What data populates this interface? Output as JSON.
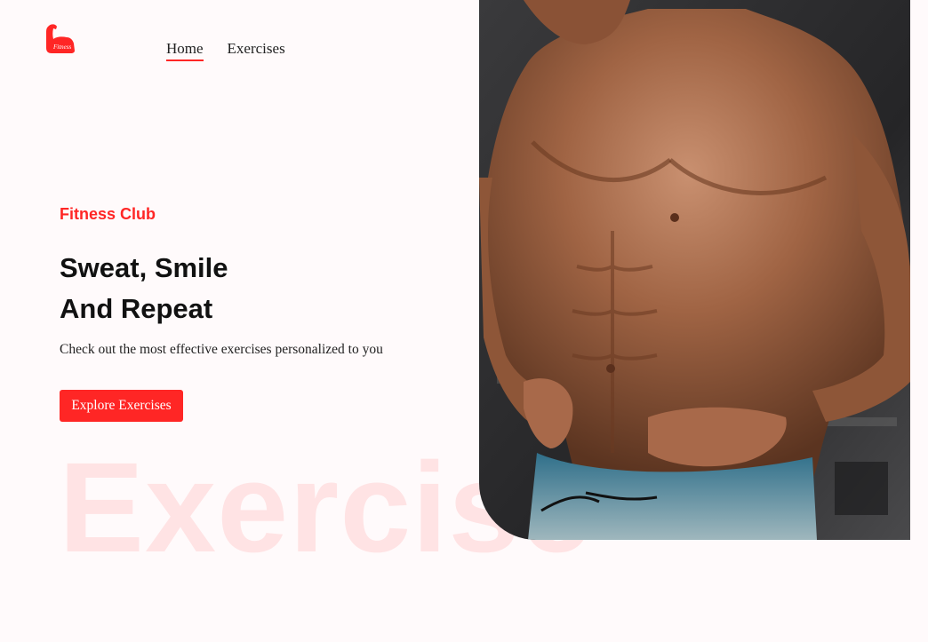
{
  "brand": {
    "logo_icon": "flexed-arm-icon",
    "logo_text": "Fitness",
    "accent_color": "#ff2625"
  },
  "nav": {
    "items": [
      {
        "label": "Home",
        "active": true
      },
      {
        "label": "Exercises",
        "active": false
      }
    ]
  },
  "hero": {
    "kicker": "Fitness Club",
    "headline_line1": "Sweat, Smile",
    "headline_line2": "And Repeat",
    "subtitle": "Check out the most effective exercises personalized to you",
    "cta_label": "Explore Exercises",
    "watermark": "Exercise",
    "image": "muscular-man-torso-photo"
  }
}
